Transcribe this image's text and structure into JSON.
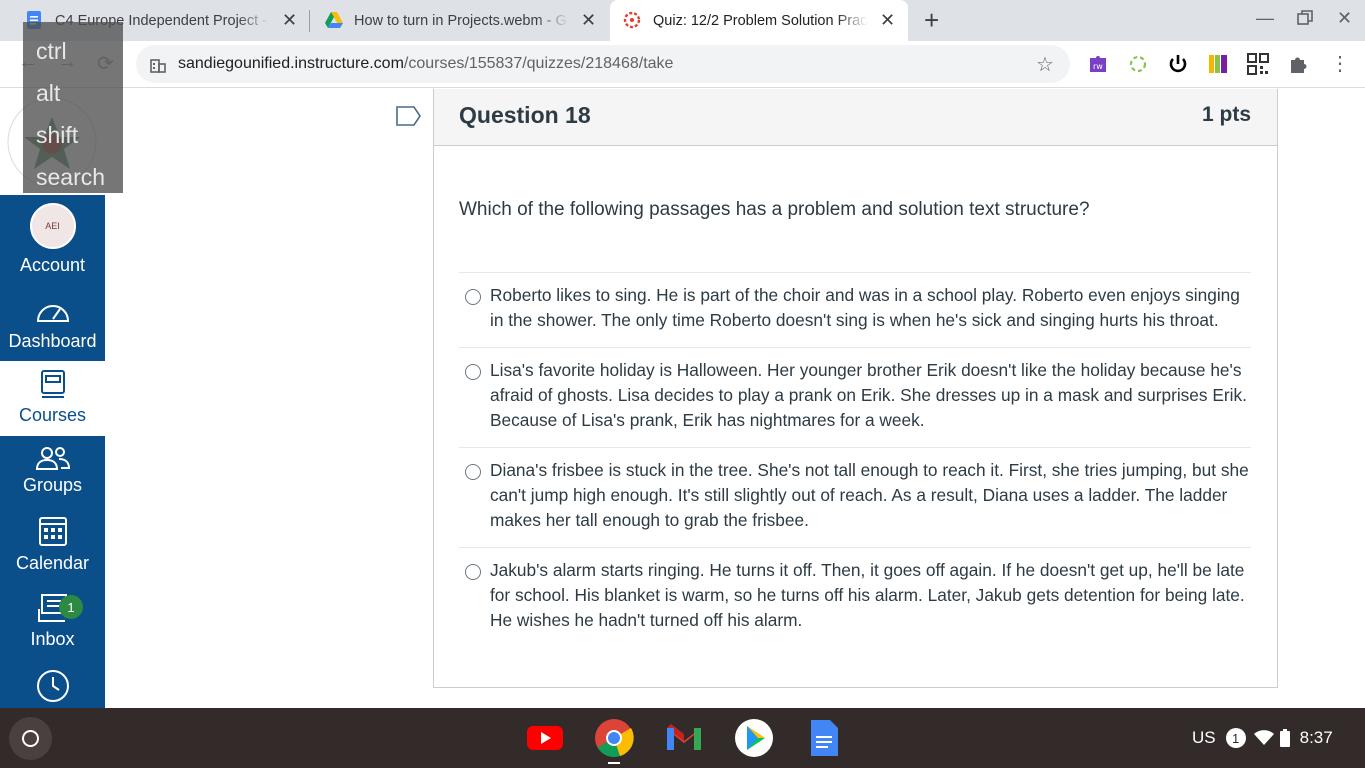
{
  "browser": {
    "tabs": [
      {
        "title": "C4 Europe Independent Project -",
        "icon": "google-docs-icon"
      },
      {
        "title": "How to turn in Projects.webm - G",
        "icon": "google-drive-icon"
      },
      {
        "title": "Quiz: 12/2 Problem Solution Prac",
        "icon": "canvas-icon",
        "active": true
      }
    ],
    "url_host": "sandiegounified.instructure.com",
    "url_path": "/courses/155837/quizzes/218468/take"
  },
  "keys_overlay": [
    "ctrl",
    "alt",
    "shift",
    "search"
  ],
  "global_nav": {
    "account": "Account",
    "dashboard": "Dashboard",
    "courses": "Courses",
    "groups": "Groups",
    "calendar": "Calendar",
    "inbox": "Inbox",
    "inbox_badge": "1",
    "avatar_text": "AEI"
  },
  "question": {
    "name": "Question 18",
    "points": "1 pts",
    "text": "Which of the following passages has a problem and solution text structure?",
    "answers": [
      "Roberto likes to sing. He is part of the choir and was in a school play. Roberto even enjoys singing in the shower. The only time Roberto doesn't sing is when he's sick and singing hurts his throat.",
      "Lisa's favorite holiday is Halloween. Her younger brother Erik doesn't like the holiday because he's afraid of ghosts. Lisa decides to play a prank on Erik. She dresses up in a mask and surprises Erik. Because of Lisa's prank, Erik has nightmares for a week.",
      "Diana's frisbee is stuck in the tree. She's not tall enough to reach it. First, she tries jumping, but she can't jump high enough. It's still slightly out of reach. As a result, Diana uses a ladder. The ladder makes her tall enough to grab the frisbee.",
      "Jakub's alarm starts ringing. He turns it off. Then, it goes off again. If he doesn't get up, he'll be late for school. His blanket is warm, so he turns off his alarm. Later, Jakub gets detention for being late. He wishes he hadn't turned off his alarm."
    ]
  },
  "tray": {
    "input": "US",
    "notifications": "1",
    "time": "8:37"
  },
  "colors": {
    "canvas_nav": "#0b4f8a",
    "shelf": "#332a2a"
  }
}
